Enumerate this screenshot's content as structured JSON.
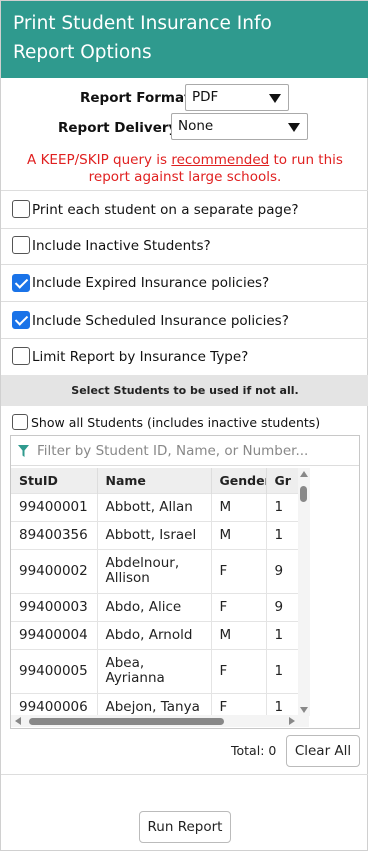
{
  "header": {
    "title_line1": "Print Student Insurance Info",
    "title_line2": "Report Options"
  },
  "colors": {
    "header_bg": "#2f9a8e",
    "warning": "#e02020",
    "checked": "#1a73e8"
  },
  "report_format": {
    "label": "Report Format:",
    "value": "PDF"
  },
  "report_delivery": {
    "label": "Report Delivery:",
    "value": "None"
  },
  "warning": {
    "pre": "A KEEP/SKIP query is ",
    "link": "recommended",
    "post": " to run this",
    "line2": "report against large schools."
  },
  "options": [
    {
      "label": "Print each student on a separate page?",
      "checked": false
    },
    {
      "label": "Include Inactive Students?",
      "checked": false
    },
    {
      "label": "Include Expired Insurance policies?",
      "checked": true
    },
    {
      "label": "Include Scheduled Insurance policies?",
      "checked": true
    },
    {
      "label": "Limit Report by Insurance Type?",
      "checked": false
    }
  ],
  "selection": {
    "band_text": "Select Students to be used if not all.",
    "show_all_label": "Show all Students (includes inactive students)",
    "filter_placeholder": "Filter by Student ID, Name, or Number...",
    "filter_icon": "filter-icon"
  },
  "grid": {
    "columns": [
      "StuID",
      "Name",
      "Gender",
      "Gr"
    ],
    "rows": [
      {
        "id": "99400001",
        "name": "Abbott, Allan",
        "gender": "M",
        "grade": "1"
      },
      {
        "id": "89400356",
        "name": "Abbott, Israel",
        "gender": "M",
        "grade": "1"
      },
      {
        "id": "99400002",
        "name": "Abdelnour, Allison",
        "gender": "F",
        "grade": "9"
      },
      {
        "id": "99400003",
        "name": "Abdo, Alice",
        "gender": "F",
        "grade": "9"
      },
      {
        "id": "99400004",
        "name": "Abdo, Arnold",
        "gender": "M",
        "grade": "1"
      },
      {
        "id": "99400005",
        "name": "Abea, Ayrianna",
        "gender": "F",
        "grade": "1"
      },
      {
        "id": "99400006",
        "name": "Abejon, Tanya",
        "gender": "F",
        "grade": "1"
      }
    ]
  },
  "total": {
    "label": "Total:",
    "value": "0"
  },
  "buttons": {
    "clear_all": "Clear All",
    "run_report": "Run Report"
  }
}
